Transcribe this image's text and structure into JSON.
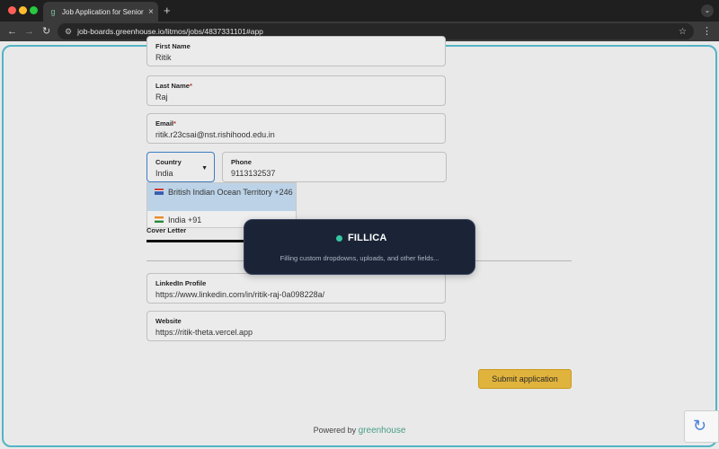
{
  "browser": {
    "tab_title": "Job Application for Senior So",
    "tab_favicon": "greenhouse-g-icon",
    "url": "job-boards.greenhouse.io/litmos/jobs/4837331101#app"
  },
  "form": {
    "first_name": {
      "label": "First Name",
      "value": "Ritik"
    },
    "last_name": {
      "label": "Last Name",
      "required_mark": "*",
      "value": "Raj"
    },
    "email": {
      "label": "Email",
      "required_mark": "*",
      "value": "ritik.r23csai@nst.rishihood.edu.in"
    },
    "country": {
      "label": "Country",
      "value": "India"
    },
    "phone": {
      "label": "Phone",
      "value": "9113132537"
    },
    "country_options": [
      {
        "label": "British Indian Ocean Territory +246",
        "flag": "biot-flag-icon",
        "highlighted": true
      },
      {
        "label": "India +91",
        "flag": "india-flag-icon",
        "highlighted": false
      }
    ],
    "cover_letter_label": "Cover Letter",
    "linkedin": {
      "label": "LinkedIn Profile",
      "value": "https://www.linkedin.com/in/ritik-raj-0a098228a/"
    },
    "website": {
      "label": "Website",
      "value": "https://ritik-theta.vercel.app"
    },
    "submit_label": "Submit application"
  },
  "toast": {
    "title": "FILLICA",
    "message": "Filling custom dropdowns, uploads, and other fields...",
    "dot_color": "#35c7a3"
  },
  "footer": {
    "powered_by": "Powered by",
    "brand": "greenhouse"
  },
  "colors": {
    "accent": "#53b4c6",
    "submit": "#e0b33c",
    "highlight": "#bcd3e7"
  }
}
